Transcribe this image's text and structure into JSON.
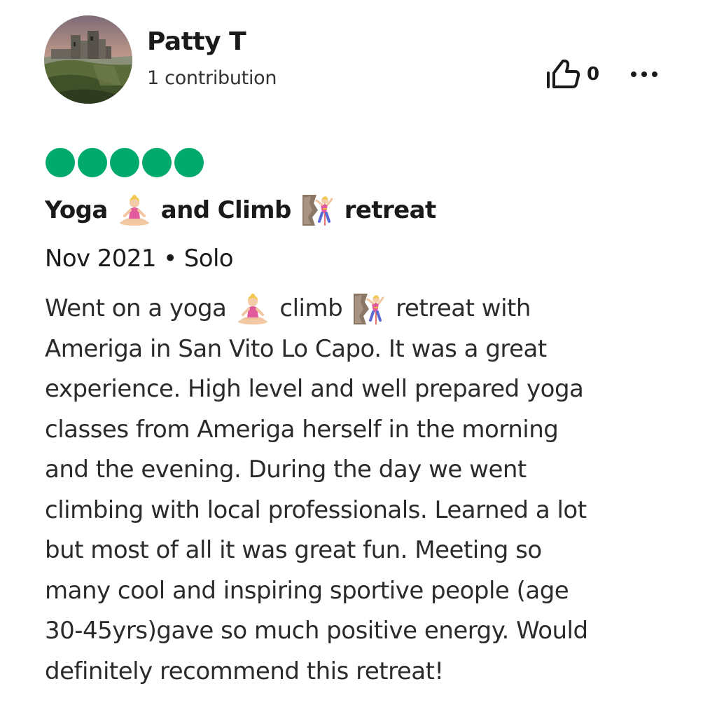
{
  "review": {
    "author": {
      "name": "Patty T",
      "contributions": "1 contribution"
    },
    "helpful_votes": "0",
    "rating_bubbles": 5,
    "rating_color": "#00aa6c",
    "title_parts": [
      "Yoga",
      "and Climb",
      "retreat"
    ],
    "title_icons": [
      "yoga-person-icon",
      "climbing-person-icon"
    ],
    "meta": "Nov 2021 • Solo",
    "body_first_line_parts": [
      "Went on a yoga",
      "climb",
      "retreat with"
    ],
    "body_lines": [
      "Ameriga in San Vito Lo Capo. It was a great",
      "experience. High level and well prepared yoga",
      "classes from Ameriga herself in the morning",
      "and the evening. During the day we went",
      "climbing with local professionals. Learned a lot",
      "but most of all it was great fun. Meeting so",
      "many cool and inspiring sportive people (age",
      "30-45yrs)gave so much positive energy. Would",
      "definitely recommend this retreat!"
    ]
  }
}
